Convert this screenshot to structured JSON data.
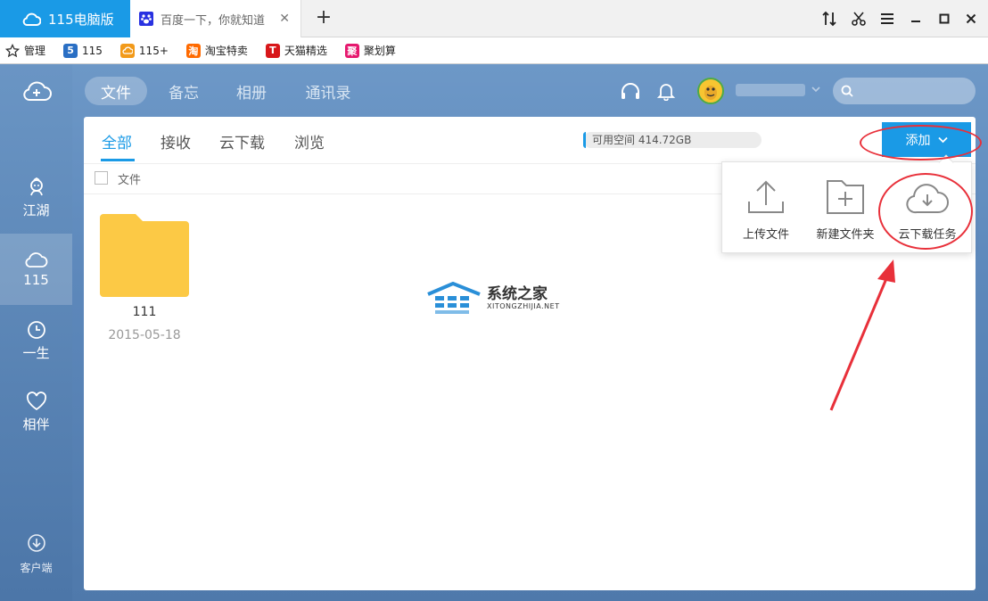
{
  "titlebar": {
    "app_tab": "115电脑版",
    "second_tab": "百度一下，你就知道",
    "close_glyph": "✕",
    "new_tab": "+",
    "controls": [
      "split-icon",
      "scissors-icon",
      "menu-icon",
      "minimize-icon",
      "maximize-icon",
      "close-icon"
    ]
  },
  "bookmarks": [
    {
      "label": "管理",
      "icon": "star-icon"
    },
    {
      "label": "115",
      "icon": "115-logo-icon",
      "badge": "5",
      "color": "#2a6fc4"
    },
    {
      "label": "115+",
      "icon": "cloud-logo-icon",
      "color": "#f29a1a"
    },
    {
      "label": "淘宝特卖",
      "icon": "taobao-icon",
      "badge": "淘",
      "color": "#ff6a00"
    },
    {
      "label": "天猫精选",
      "icon": "tmall-icon",
      "badge": "T",
      "color": "#d8171a"
    },
    {
      "label": "聚划算",
      "icon": "juhuasuan-icon",
      "badge": "聚",
      "color": "#e6186e"
    }
  ],
  "sidebar": {
    "items": [
      {
        "label": "江湖",
        "icon": "jianghu-icon"
      },
      {
        "label": "115",
        "icon": "cloud-icon"
      },
      {
        "label": "一生",
        "icon": "clock-icon"
      },
      {
        "label": "相伴",
        "icon": "heart-icon"
      }
    ],
    "client_label": "客户端"
  },
  "topnav": {
    "tabs": [
      "文件",
      "备忘",
      "相册",
      "通讯录"
    ],
    "search_placeholder": ""
  },
  "subtabs": [
    "全部",
    "接收",
    "云下载",
    "浏览"
  ],
  "quota": {
    "text": "可用空间 414.72GB"
  },
  "add_button": "添加",
  "list": {
    "header": "文件",
    "items": [
      {
        "name": "111",
        "date": "2015-05-18"
      }
    ]
  },
  "dropdown": {
    "items": [
      {
        "label": "上传文件",
        "icon": "upload-icon"
      },
      {
        "label": "新建文件夹",
        "icon": "new-folder-icon"
      },
      {
        "label": "云下载任务",
        "icon": "cloud-download-icon"
      }
    ]
  },
  "watermark": {
    "title": "系统之家",
    "subtitle": "XITONGZHIJIA.NET"
  },
  "colors": {
    "accent": "#1a9ae6",
    "folder": "#fcc945",
    "annotation": "#e8303a"
  }
}
